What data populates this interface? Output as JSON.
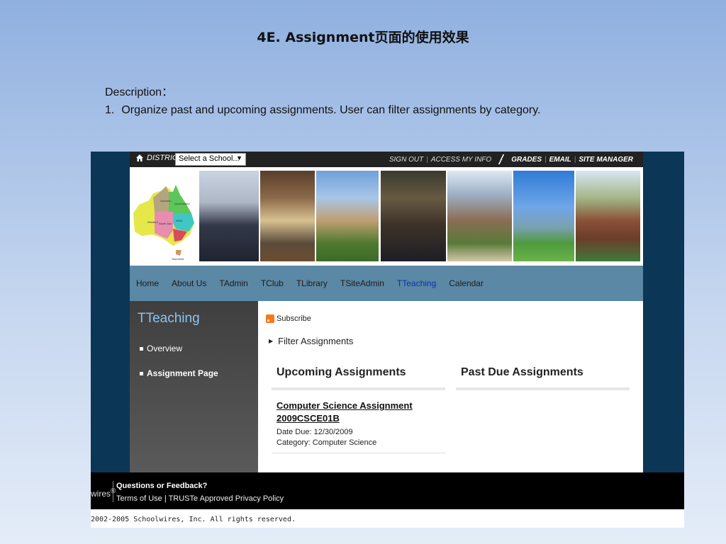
{
  "slide": {
    "title": "4E. Assignment页面的使用效果",
    "description_label": "Description：",
    "items": [
      {
        "num": "1.",
        "text": "Organize past and upcoming assignments. User can filter assignments by category."
      }
    ]
  },
  "topbar": {
    "district": "DISTRICT",
    "school_select": "Select a School...",
    "links": [
      "SIGN OUT",
      "ACCESS MY INFO"
    ],
    "bold_links": [
      "GRADES",
      "EMAIL",
      "SITE MANAGER"
    ]
  },
  "banner": {
    "map_label": "Tasmania"
  },
  "nav": {
    "items": [
      "Home",
      "About Us",
      "TAdmin",
      "TClub",
      "TLibrary",
      "TSiteAdmin",
      "TTeaching",
      "Calendar"
    ],
    "active": "TTeaching"
  },
  "sidebar": {
    "title": "TTeaching",
    "links": [
      "Overview",
      "Assignment Page"
    ],
    "active": "Assignment Page"
  },
  "main": {
    "subscribe": "Subscribe",
    "filter": "Filter Assignments",
    "upcoming_heading": "Upcoming Assignments",
    "past_due_heading": "Past Due Assignments",
    "assignment": {
      "title_line1": "Computer Science Assignment",
      "title_line2": "2009CSCE01B",
      "date_due": "Date Due: 12/30/2009",
      "category": "Category: Computer Science"
    }
  },
  "footer": {
    "logo": "wires",
    "logo_mark": "®",
    "questions": "Questions or Feedback?",
    "links": "Terms of Use | TRUSTe Approved Privacy Policy",
    "copyright": "2002-2005 Schoolwires, Inc. All rights reserved."
  },
  "colors": {
    "slide_bg_top": "#90b0e0",
    "nav_bg": "#5b88a4",
    "sidebar_title": "#8cc3f0",
    "active_nav": "#0b2fb0",
    "frame": "#0b3656"
  }
}
